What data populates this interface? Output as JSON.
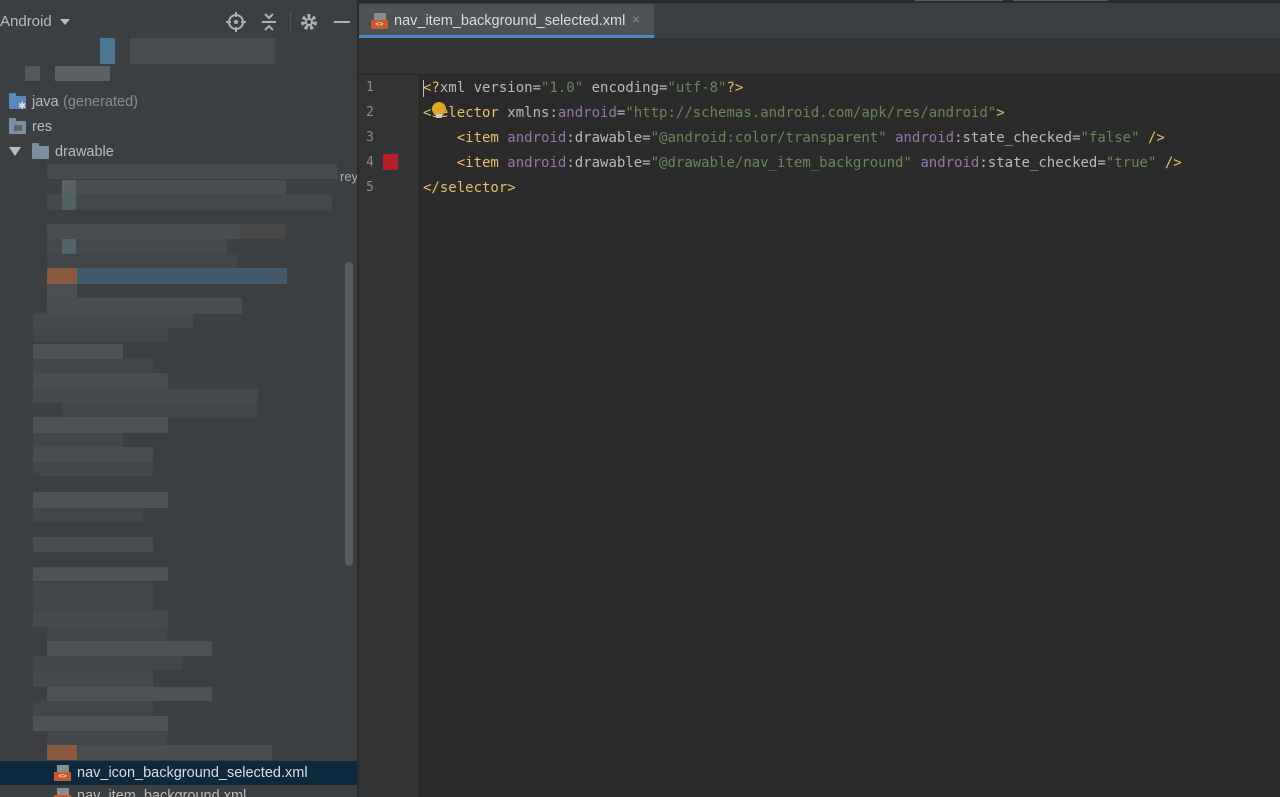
{
  "project_panel": {
    "view_selector": "Android",
    "tree": {
      "java_label": "java",
      "java_note": "(generated)",
      "res_label": "res",
      "drawable_label": "drawable"
    },
    "cut_text": "rey",
    "files": [
      {
        "label": "nav_icon_background_selected.xml",
        "selected": true
      },
      {
        "label": "nav_item_background.xml",
        "selected": false
      }
    ]
  },
  "editor": {
    "tab_title": "nav_item_background_selected.xml",
    "tab_close": "×",
    "line_numbers": [
      "1",
      "2",
      "3",
      "4",
      "5"
    ],
    "code": [
      {
        "a": "<?",
        "b": "xml version",
        "c": "=",
        "d": "\"1.0\"",
        "e": " encoding",
        "f": "=",
        "g": "\"utf-8\"",
        "h": "?>"
      },
      {
        "a": "<selector ",
        "b": "xmlns:",
        "c": "android",
        "d": "=",
        "e": "\"http://schemas.android.com/apk/res/android\"",
        "f": ">"
      },
      {
        "indent": "    ",
        "a": "<item ",
        "b": "android",
        "c": ":drawable",
        "d": "=",
        "e": "\"@android:color/transparent\"",
        "f": " ",
        "g": "android",
        "h": ":state_checked",
        "i": "=",
        "j": "\"false\"",
        "k": " />"
      },
      {
        "indent": "    ",
        "a": "<item ",
        "b": "android",
        "c": ":drawable",
        "d": "=",
        "e": "\"@drawable/nav_item_background\"",
        "f": " ",
        "g": "android",
        "h": ":state_checked",
        "i": "=",
        "j": "\"true\"",
        "k": " />"
      },
      {
        "a": "</selector>"
      }
    ],
    "swatch_color": "#b32126"
  },
  "icons": [
    "locate-icon",
    "collapse-all-icon",
    "gear-icon",
    "minimize-icon",
    "xml-file-icon",
    "close-icon",
    "intention-bulb-icon"
  ]
}
